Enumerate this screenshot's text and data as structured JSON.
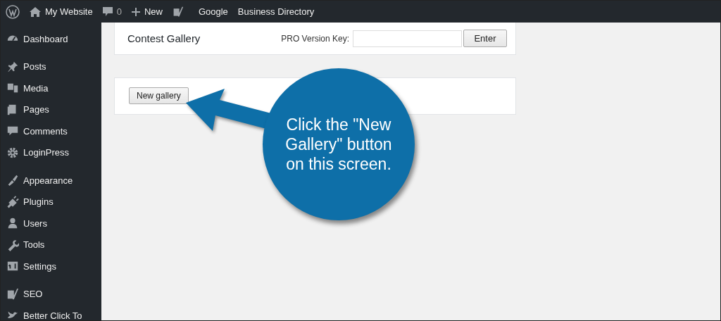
{
  "admin_bar": {
    "site": "My Website",
    "comments": "0",
    "new": "New",
    "links": [
      "Google",
      "Business Directory"
    ]
  },
  "sidebar": {
    "groups": [
      [
        {
          "label": "Dashboard"
        }
      ],
      [
        {
          "label": "Posts"
        },
        {
          "label": "Media"
        },
        {
          "label": "Pages"
        },
        {
          "label": "Comments"
        },
        {
          "label": "LoginPress"
        }
      ],
      [
        {
          "label": "Appearance"
        },
        {
          "label": "Plugins"
        },
        {
          "label": "Users"
        },
        {
          "label": "Tools"
        },
        {
          "label": "Settings"
        }
      ],
      [
        {
          "label": "SEO"
        },
        {
          "label": "Better Click To"
        }
      ]
    ]
  },
  "header_card": {
    "title": "Contest Gallery",
    "key_label": "PRO Version Key:",
    "enter_button": "Enter"
  },
  "gallery_card": {
    "new_gallery_button": "New gallery"
  },
  "callout": {
    "text": "Click the \"New Gallery\" button on this screen."
  }
}
